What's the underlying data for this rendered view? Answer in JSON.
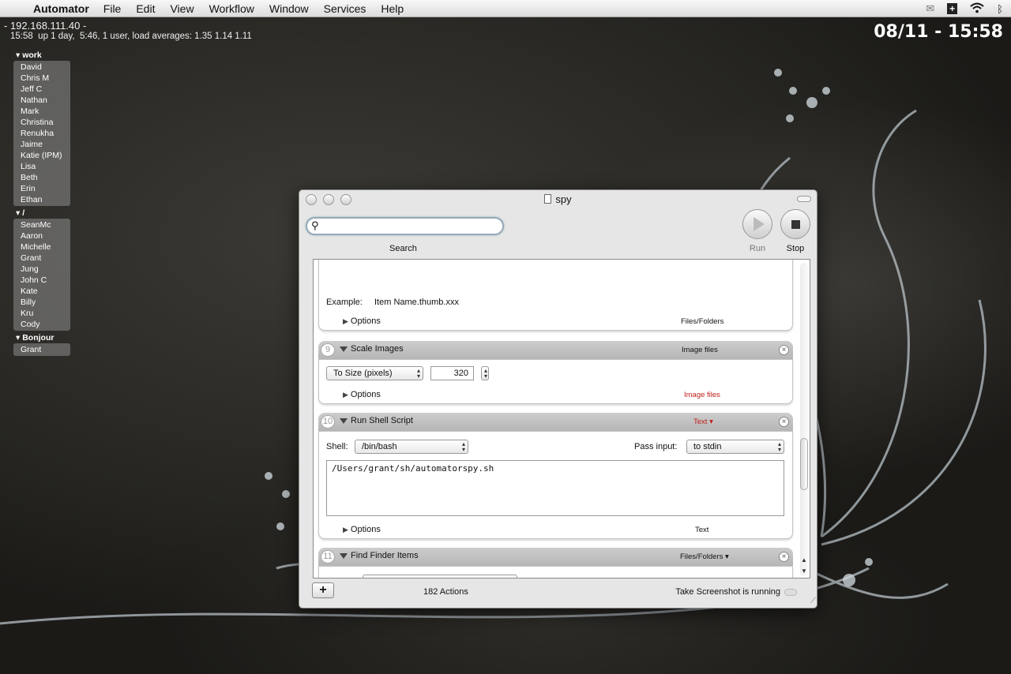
{
  "menubar": {
    "app_name": "Automator",
    "items": [
      "File",
      "Edit",
      "View",
      "Workflow",
      "Window",
      "Services",
      "Help"
    ],
    "right_icons": [
      "mail-icon",
      "plus-box-icon",
      "wifi-icon",
      "bluetooth-icon"
    ]
  },
  "desktop": {
    "host_line": "- 192.168.111.40 -",
    "uptime_line": "15:58  up 1 day,  5:46, 1 user, load averages: 1.35 1.14 1.11",
    "clock": "08/11 - 15:58"
  },
  "buddy_list": {
    "groups": [
      {
        "name": "work",
        "members": [
          "David",
          "Chris M",
          "Jeff C",
          "Nathan",
          "Mark",
          "Christina",
          "Renukha",
          "Jaime",
          "Katie (IPM)",
          "Lisa",
          "Beth",
          "Erin",
          "Ethan"
        ]
      },
      {
        "name": "/",
        "members": [
          "SeanMc",
          "Aaron",
          "Michelle",
          "Grant",
          "Jung",
          "John C",
          "Kate",
          "Billy",
          "Kru",
          "Cody"
        ]
      },
      {
        "name": "Bonjour",
        "members": [
          "Grant"
        ]
      }
    ]
  },
  "window": {
    "title": "spy",
    "search": {
      "placeholder": "",
      "label": "Search"
    },
    "run_label": "Run",
    "stop_label": "Stop",
    "prev_card": {
      "example_label": "Example:",
      "example_value": "Item Name.thumb.xxx",
      "options": "Options",
      "footer": "Files/Folders"
    },
    "card9": {
      "num": "9",
      "name": "Scale Images",
      "type": "Image files",
      "mode": "To Size (pixels)",
      "size": "320",
      "options": "Options",
      "footer": "Image files"
    },
    "card10": {
      "num": "10",
      "name": "Run Shell Script",
      "type": "Text",
      "shell_label": "Shell:",
      "shell": "/bin/bash",
      "pass_label": "Pass input:",
      "pass": "to stdin",
      "script": "/Users/grant/sh/automatorspy.sh",
      "options": "Options",
      "footer": "Text"
    },
    "card11": {
      "num": "11",
      "name": "Find Finder Items",
      "type": "Files/Folders"
    },
    "actions_count": "182 Actions",
    "status": "Take Screenshot is running"
  },
  "colors": {
    "accent_red": "#c0201a",
    "desktop": "#2b2a26"
  }
}
